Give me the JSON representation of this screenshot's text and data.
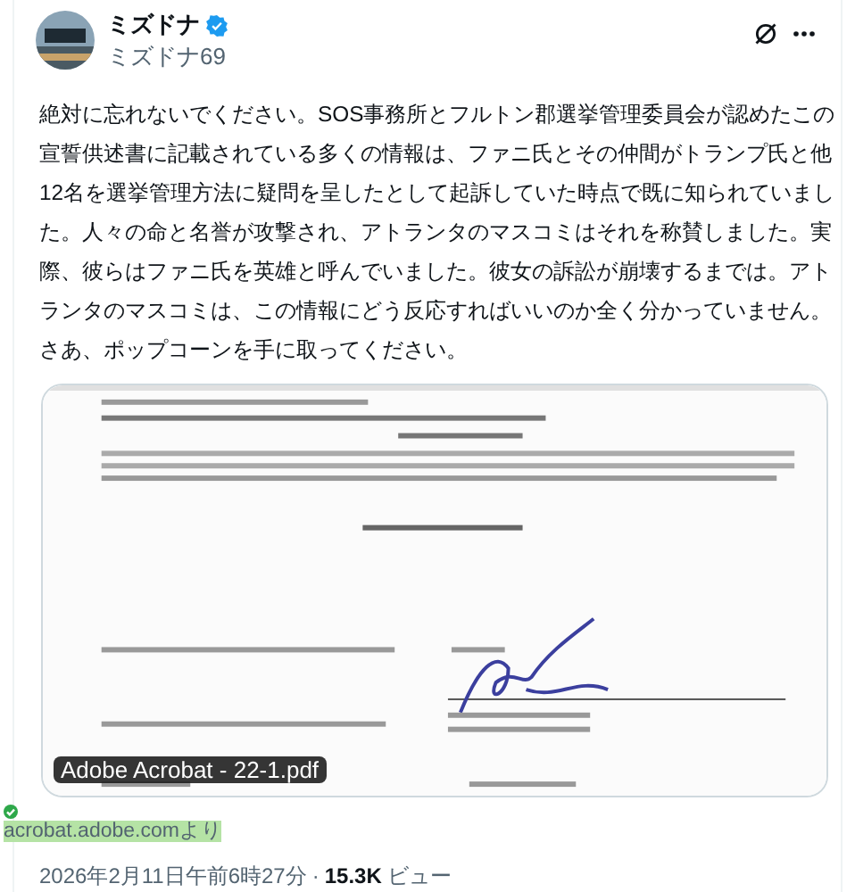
{
  "author": {
    "name": "ミズドナ",
    "verified": true,
    "handle": "ミズドナ69"
  },
  "post": {
    "text": "絶対に忘れないでください。SOS事務所とフルトン郡選挙管理委員会が認めたこの宣誓供述書に記載されている多くの情報は、ファニ氏とその仲間がトランプ氏と他12名を選挙管理方法に疑問を呈したとして起訴していた時点で既に知られていました。人々の命と名誉が攻撃され、アトランタのマスコミはそれを称賛しました。実際、彼らはファニ氏を英雄と呼んでいました。彼女の訴訟が崩壊するまでは。アトランタのマスコミは、この情報にどう反応すればいいのか全く分かっていません。さあ、ポップコーンを手に取ってください。"
  },
  "attachment": {
    "kind": "picture",
    "badge": "Adobe Acrobat - 22-1.pdf"
  },
  "source": {
    "verified": true,
    "label": "acrobat.adobe.comより"
  },
  "meta": {
    "time": "2026年2月11日午前6時27分",
    "separator": "·",
    "views": "15.3K",
    "views_label": "ビュー"
  }
}
